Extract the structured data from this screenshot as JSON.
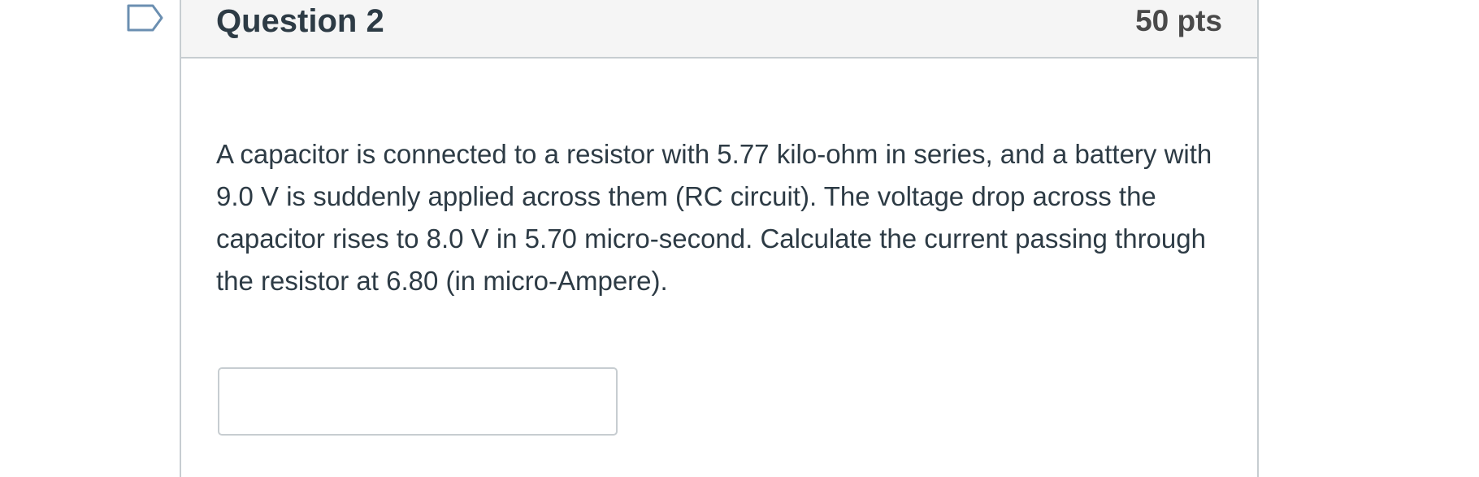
{
  "question": {
    "title": "Question 2",
    "points": "50 pts",
    "flag_icon": "bookmark-flag-icon",
    "text": "A capacitor is connected to a resistor with 5.77 kilo-ohm in series, and a battery with 9.0 V is suddenly applied across them (RC circuit). The voltage drop across the capacitor rises to 8.0 V in 5.70 micro-second. Calculate the current passing through the resistor at 6.80 (in micro-Ampere).",
    "answer": {
      "value": "",
      "placeholder": ""
    }
  },
  "colors": {
    "header_bg": "#f5f5f5",
    "border": "#c7cdd1",
    "text": "#2d3b45",
    "points_text": "#4a4a4a",
    "flag_stroke": "#6b8fb1"
  }
}
